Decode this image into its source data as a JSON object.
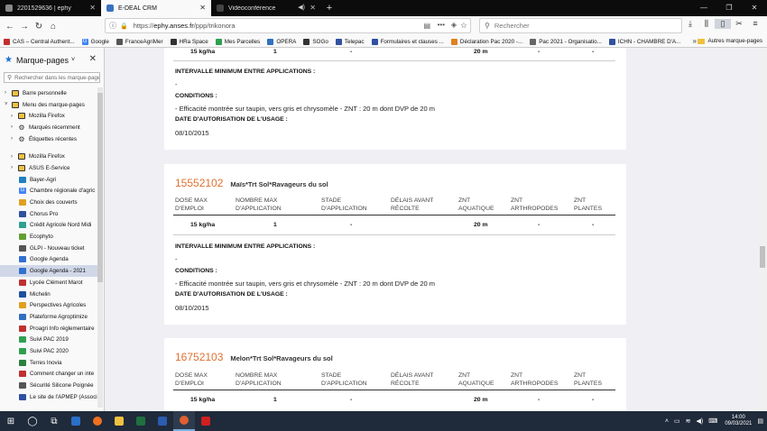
{
  "browser": {
    "tabs": [
      {
        "title": "2201529636 | ephy",
        "active": false,
        "fav_color": "#888"
      },
      {
        "title": "E-DEAL CRM",
        "active": true,
        "fav_color": "#3a70c0"
      },
      {
        "title": "Vidéoconférence",
        "active": false,
        "fav_color": "#444"
      }
    ],
    "url_host": "ephy.anses.fr",
    "url_prefix": "https://",
    "url_path": "/ppp/trikonora",
    "search_placeholder": "Rechercher"
  },
  "bookmarks_bar": [
    {
      "label": "CAS – Central Authent...",
      "color": "#c03030"
    },
    {
      "label": "Google",
      "color": "#4285f4"
    },
    {
      "label": "FranceAgriMer",
      "color": "#555"
    },
    {
      "label": "HRa Space",
      "color": "#333"
    },
    {
      "label": "Mes Parcelles",
      "color": "#30a050"
    },
    {
      "label": "OPERA",
      "color": "#3070c0"
    },
    {
      "label": "SOGo",
      "color": "#333"
    },
    {
      "label": "Telepac",
      "color": "#3050a0"
    },
    {
      "label": "Formulaires et clauses ...",
      "color": "#3050a0"
    },
    {
      "label": "Déclaration Pac 2020 -...",
      "color": "#e08020"
    },
    {
      "label": "Pac 2021 - Organisatio...",
      "color": "#666"
    },
    {
      "label": "ICHN - CHAMBRE D'A...",
      "color": "#3050a0"
    }
  ],
  "other_bookmarks": "Autres marque-pages",
  "sidebar": {
    "title": "Marque-pages",
    "search_placeholder": "Rechercher dans les marque-pages",
    "items": [
      {
        "label": "Barre personnelle",
        "type": "folder",
        "arrow": "›"
      },
      {
        "label": "Menu des marque-pages",
        "type": "folder",
        "arrow": "˅"
      },
      {
        "label": "Mozilla Firefox",
        "type": "folder",
        "arrow": "›",
        "indent": true
      },
      {
        "label": "Marqués récemment",
        "type": "gear",
        "arrow": "›",
        "indent": true
      },
      {
        "label": "Étiquettes récentes",
        "type": "gear",
        "arrow": "›",
        "indent": true
      },
      {
        "label": "Mozilla Firefox",
        "type": "folder",
        "arrow": "›",
        "indent": true,
        "gap": true
      },
      {
        "label": "ASUS E-Service",
        "type": "folder",
        "arrow": "›",
        "indent": true
      },
      {
        "label": "Bayer-Agri",
        "type": "site",
        "color": "#2080c0"
      },
      {
        "label": "Chambre régionale d'agric",
        "type": "site",
        "color": "#4285f4",
        "glyph": "G"
      },
      {
        "label": "Choix des couverts",
        "type": "site",
        "color": "#e0a020"
      },
      {
        "label": "Chorus Pro",
        "type": "site",
        "color": "#3050a0"
      },
      {
        "label": "Crédit Agricole Nord Midi",
        "type": "site",
        "color": "#30a090"
      },
      {
        "label": "Ecophyto",
        "type": "site",
        "color": "#60a030"
      },
      {
        "label": "GLPI - Nouveau ticket",
        "type": "site",
        "color": "#555"
      },
      {
        "label": "Google Agenda",
        "type": "site",
        "color": "#3070d0"
      },
      {
        "label": "Google Agenda - 2021",
        "type": "site",
        "color": "#3070d0",
        "selected": true
      },
      {
        "label": "Lycée Clément Marot",
        "type": "site",
        "color": "#c03030"
      },
      {
        "label": "Michelin",
        "type": "site",
        "color": "#2050a0"
      },
      {
        "label": "Perspectives Agricoles",
        "type": "site",
        "color": "#e0a020"
      },
      {
        "label": "Plateforme Agroptimize",
        "type": "site",
        "color": "#3070c0"
      },
      {
        "label": "Proagri Info réglementaire",
        "type": "site",
        "color": "#c03030"
      },
      {
        "label": "Suivi PAC 2019",
        "type": "site",
        "color": "#30a050"
      },
      {
        "label": "Suivi PAC 2020",
        "type": "site",
        "color": "#30a050"
      },
      {
        "label": "Terres Inovia",
        "type": "site",
        "color": "#2a8040"
      },
      {
        "label": "Comment changer un inte",
        "type": "site",
        "color": "#c03030"
      },
      {
        "label": "Sécurité Silicone Poignée",
        "type": "site",
        "color": "#555"
      },
      {
        "label": "Le site de l'APMEP (Associ",
        "type": "site",
        "color": "#3050a0"
      }
    ]
  },
  "content": {
    "columns": [
      "DOSE MAX D'EMPLOI",
      "NOMBRE MAX D'APPLICATION",
      "STADE D'APPLICATION",
      "DÉLAIS AVANT RÉCOLTE",
      "ZNT AQUATIQUE",
      "ZNT ARTHROPODES",
      "ZNT PLANTES"
    ],
    "col_first": [
      "DOSE MAX",
      "D'EMPLOI"
    ],
    "col_second": [
      "NOMBRE MAX",
      "D'APPLICATION"
    ],
    "col_third": [
      "STADE",
      "D'APPLICATION"
    ],
    "col_fourth": [
      "DÉLAIS AVANT",
      "RÉCOLTE"
    ],
    "col_fifth": [
      "ZNT",
      "AQUATIQUE"
    ],
    "col_sixth": [
      "ZNT",
      "ARTHROPODES"
    ],
    "col_seventh": [
      "ZNT",
      "PLANTES"
    ],
    "row_values": {
      "dose": "15 kg/ha",
      "nb": "1",
      "stade": "-",
      "delais": "",
      "znt_aqua": "20 m",
      "znt_arth": "-",
      "znt_plantes": "-"
    },
    "interval_label": "INTERVALLE MINIMUM ENTRE APPLICATIONS :",
    "interval_value": "-",
    "conditions_label": "CONDITIONS :",
    "conditions_value": "- Efficacité montrée sur taupin, vers gris et chrysomèle - ZNT : 20 m dont DVP de 20 m",
    "date_label": "DATE D'AUTORISATION DE L'USAGE :",
    "date_value": "08/10/2015",
    "products": [
      {
        "code": "15552102",
        "title": "Maïs*Trt Sol*Ravageurs du sol"
      },
      {
        "code": "16752103",
        "title": "Melon*Trt Sol*Ravageurs du sol"
      }
    ]
  },
  "taskbar": {
    "time": "14:00",
    "date": "09/03/2021"
  }
}
